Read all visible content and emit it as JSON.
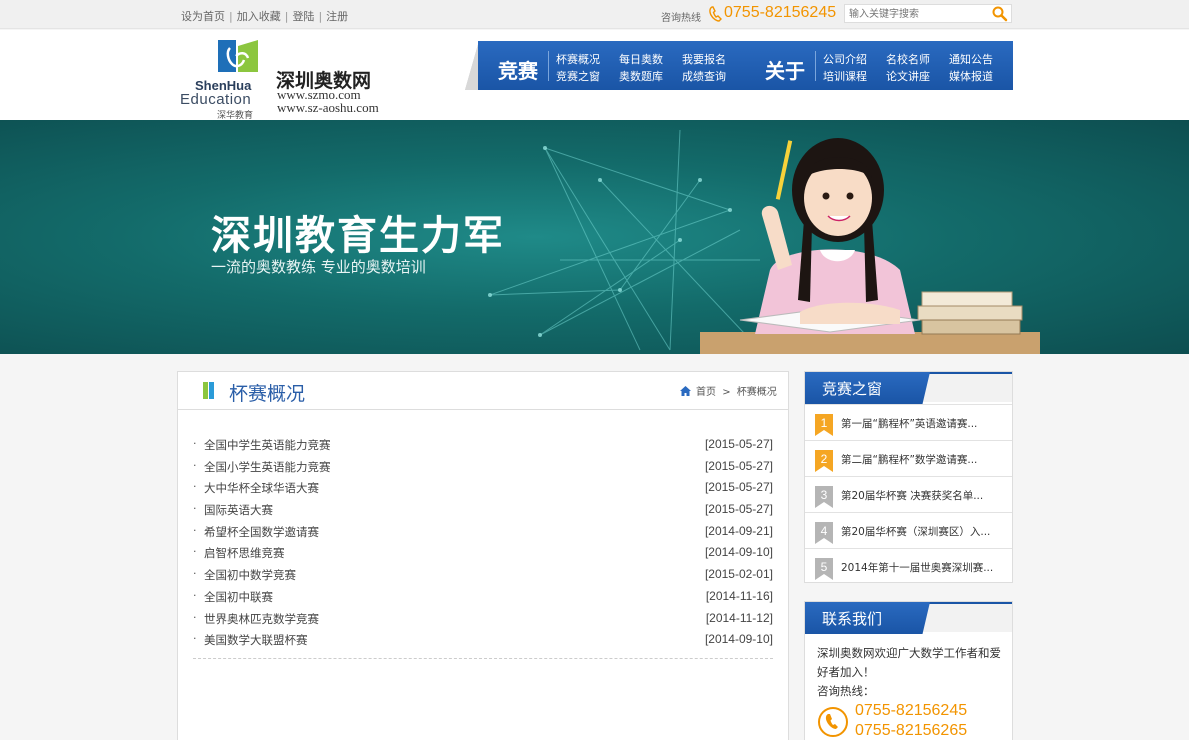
{
  "topbar": {
    "links": [
      "设为首页",
      "加入收藏",
      "登陆",
      "注册"
    ],
    "hotline_label": "咨询热线",
    "hotline_number": "0755-82156245",
    "search_placeholder": "输入关键字搜索"
  },
  "header": {
    "logo_en_line1": "ShenHua",
    "logo_en_line2": "Education",
    "logo_cn": "深华教育",
    "site_name": "深圳奥数网",
    "url1": "www.szmo.com",
    "url2": "www.sz-aoshu.com"
  },
  "nav": {
    "group1_title": "竞赛",
    "group1_items": [
      "杯赛概况",
      "竞赛之窗",
      "每日奥数",
      "奥数题库",
      "我要报名",
      "成绩查询"
    ],
    "group2_title": "关于",
    "group2_items": [
      "公司介绍",
      "培训课程",
      "名校名师",
      "论文讲座",
      "通知公告",
      "媒体报道"
    ]
  },
  "banner": {
    "title": "深圳教育生力军",
    "subtitle": "一流的奥数教练  专业的奥数培训"
  },
  "main": {
    "section_title": "杯赛概况",
    "breadcrumb_home": "首页",
    "breadcrumb_sep": ">",
    "breadcrumb_current": "杯赛概况",
    "items": [
      {
        "title": "全国中学生英语能力竞赛",
        "date": "[2015-05-27]"
      },
      {
        "title": "全国小学生英语能力竞赛",
        "date": "[2015-05-27]"
      },
      {
        "title": "大中华杯全球华语大赛",
        "date": "[2015-05-27]"
      },
      {
        "title": "国际英语大赛",
        "date": "[2015-05-27]"
      },
      {
        "title": "希望杯全国数学邀请赛",
        "date": "[2014-09-21]"
      },
      {
        "title": "启智杯思维竞赛",
        "date": "[2014-09-10]"
      },
      {
        "title": "全国初中数学竞赛",
        "date": "[2015-02-01]"
      },
      {
        "title": "全国初中联赛",
        "date": "[2014-11-16]"
      },
      {
        "title": "世界奥林匹克数学竞赛",
        "date": "[2014-11-12]"
      },
      {
        "title": "美国数学大联盟杯赛",
        "date": "[2014-09-10]"
      }
    ]
  },
  "sidebar": {
    "window_title": "竞赛之窗",
    "ranks": [
      {
        "num": "1",
        "text": "第一届“鹏程杯”英语邀请赛..."
      },
      {
        "num": "2",
        "text": "第二届“鹏程杯”数学邀请赛..."
      },
      {
        "num": "3",
        "text": "第20届华杯赛 决赛获奖名单..."
      },
      {
        "num": "4",
        "text": "第20届华杯赛（深圳赛区）入..."
      },
      {
        "num": "5",
        "text": "2014年第十一届世奥赛深圳赛..."
      }
    ],
    "contact_title": "联系我们",
    "contact_text": "深圳奥数网欢迎广大数学工作者和爱好者加入！",
    "contact_hotline_label": "咨询热线：",
    "contact_numbers": [
      "0755-82156245",
      "0755-82156265"
    ]
  },
  "colors": {
    "accent_blue": "#1a55a6",
    "accent_orange": "#f29400",
    "rank_top": "#f5a623",
    "rank_other": "#b5b5b5"
  }
}
